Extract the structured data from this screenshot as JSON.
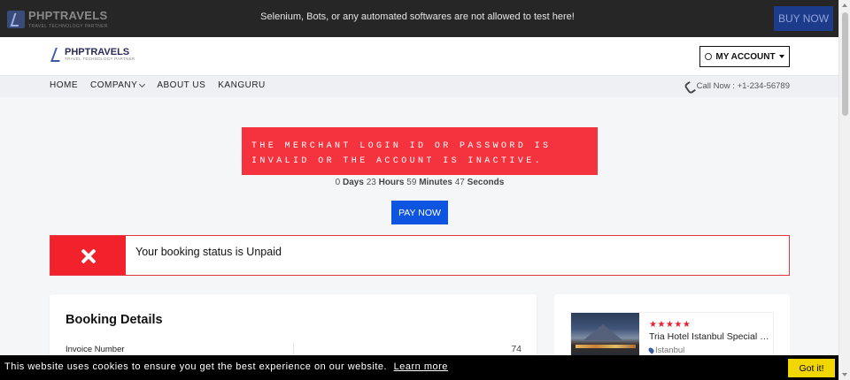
{
  "topbar": {
    "logo_name": "PHPTRAVELS",
    "logo_tagline": "TRAVEL TECHNOLOGY PARTNER",
    "notice": "Selenium, Bots, or any automated softwares are not allowed to test here!",
    "buy_now": "BUY NOW"
  },
  "header": {
    "brand_name": "PHPTRAVELS",
    "brand_tagline": "TRAVEL TECHNOLOGY PARTNER",
    "account_label": "MY ACCOUNT"
  },
  "nav": {
    "items": [
      {
        "label": "HOME"
      },
      {
        "label": "COMPANY"
      },
      {
        "label": "ABOUT US"
      },
      {
        "label": "KANGURU"
      }
    ],
    "call_now": "Call Now : +1-234-56789"
  },
  "error_message": "THE MERCHANT LOGIN ID OR PASSWORD IS INVALID OR THE ACCOUNT IS INACTIVE.",
  "timer": {
    "days": "0",
    "days_label": "Days",
    "hours": "23",
    "hours_label": "Hours",
    "minutes": "59",
    "minutes_label": "Minutes",
    "seconds": "47",
    "seconds_label": "Seconds"
  },
  "pay_now": "PAY NOW",
  "booking_status": "Your booking status is Unpaid",
  "booking_details": {
    "title": "Booking Details",
    "invoice_label": "Invoice Number",
    "invoice_value": "74"
  },
  "hotel": {
    "stars": "★★★★★",
    "name": "Tria Hotel Istanbul Special Class",
    "city": "Istanbul"
  },
  "cookie": {
    "text": "This website uses cookies to ensure you get the best experience on our website.",
    "learn_more": "Learn more",
    "got_it": "Got it!"
  }
}
